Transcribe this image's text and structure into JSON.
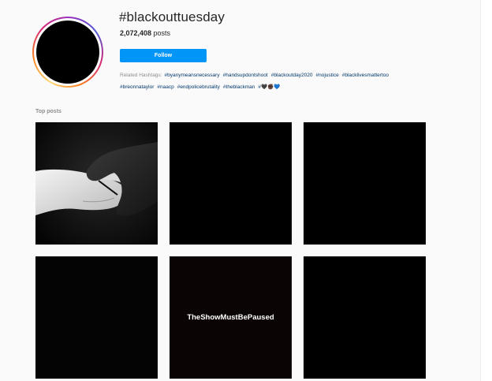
{
  "header": {
    "hashtag": "#blackouttuesday",
    "post_count": "2,072,408",
    "post_count_suffix": " posts",
    "follow_label": "Follow"
  },
  "related": {
    "label": "Related Hashtags:",
    "tags": [
      "#byanymeansnecessary",
      "#handsupdontshoot",
      "#blackoutday2020",
      "#nojustice",
      "#blacklivesmattertoo",
      "#breonnataylor",
      "#naacp",
      "#endpolicebrutality",
      "#theblackman",
      "#🖤✊🏿💙"
    ]
  },
  "top_posts": {
    "title": "Top posts",
    "tiles": [
      {
        "caption": ""
      },
      {
        "caption": ""
      },
      {
        "caption": ""
      },
      {
        "caption": ""
      },
      {
        "caption": "TheShowMustBePaused"
      },
      {
        "caption": ""
      }
    ]
  },
  "colors": {
    "follow_blue": "#0095f6",
    "link_blue": "#00376b",
    "muted_gray": "#8e8e8e",
    "text_dark": "#262626"
  }
}
